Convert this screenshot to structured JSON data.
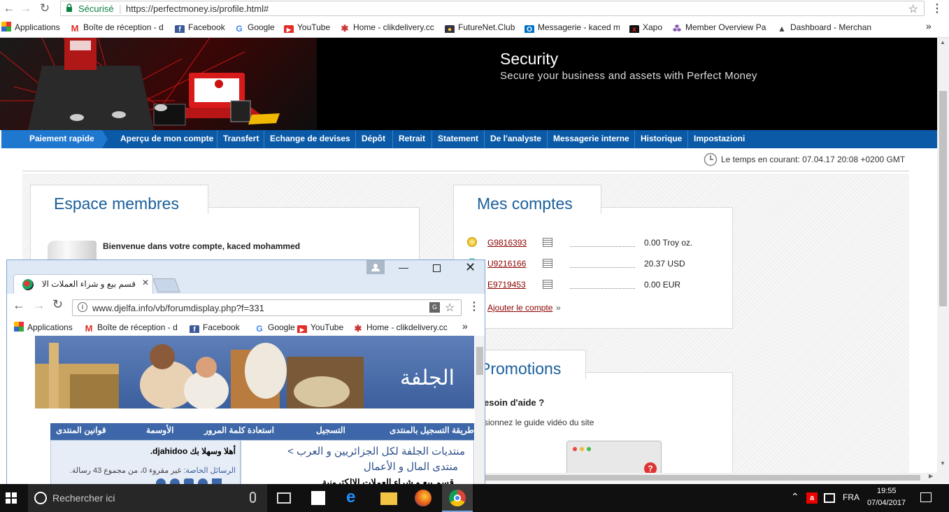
{
  "browser": {
    "secure_label": "Sécurisé",
    "url": "https://perfectmoney.is/profile.html#",
    "bookmarks": [
      {
        "label": "Applications",
        "icon": "apps-grid-icon"
      },
      {
        "label": "Boîte de réception - d",
        "icon": "gmail-icon"
      },
      {
        "label": "Facebook",
        "icon": "facebook-icon"
      },
      {
        "label": "Google",
        "icon": "google-icon"
      },
      {
        "label": "YouTube",
        "icon": "youtube-icon"
      },
      {
        "label": "Home - clikdelivery.cc",
        "icon": "clikdelivery-icon"
      },
      {
        "label": "FutureNet.Club",
        "icon": "futurenet-icon"
      },
      {
        "label": "Messagerie - kaced m",
        "icon": "outlook-icon"
      },
      {
        "label": "Xapo",
        "icon": "xapo-icon"
      },
      {
        "label": "Member Overview Pa",
        "icon": "member-icon"
      },
      {
        "label": "Dashboard - Merchan",
        "icon": "dashboard-icon"
      }
    ],
    "overflow": "»"
  },
  "pm": {
    "hero_title": "Security",
    "hero_subtitle": "Secure your business and assets with Perfect Money",
    "nav": [
      "Paiement rapide",
      "Aperçu de mon compte",
      "Transfert",
      "Echange de devises",
      "Dépôt",
      "Retrait",
      "Statement",
      "De l'analyste",
      "Messagerie interne",
      "Historique",
      "Impostazioni"
    ],
    "time": "Le temps en courant: 07.04.17 20:08 +0200 GMT",
    "members_title": "Espace membres",
    "welcome": "Bienvenue dans votre compte, kaced mohammed",
    "accounts_title": "Mes comptes",
    "accounts": [
      {
        "id": "G9816393",
        "balance": "0.00 Troy oz."
      },
      {
        "id": "U9216166",
        "balance": "20.37 USD"
      },
      {
        "id": "E9719453",
        "balance": "0.00 EUR"
      }
    ],
    "add_account": "Ajouter le compte",
    "add_account_arrow": "»",
    "promotions_title": "Promotions",
    "help_title": "esoin d'aide ?",
    "help_text": "sionnez le guide vidéo du site"
  },
  "forum": {
    "tab_title": "قسم بيع و شراء العملات الا",
    "url": "www.djelfa.info/vb/forumdisplay.php?f=331",
    "bookmarks": [
      "Applications",
      "Boîte de réception - d",
      "Facebook",
      "Google",
      "YouTube",
      "Home - clikdelivery.cc"
    ],
    "overflow": "»",
    "menu": [
      "قوانين المنتدى",
      "الأوسمة",
      "استعادة كلمة المرور",
      "التسجيل",
      "طريقة التسجيل بالمنتدى"
    ],
    "welcome": "أهلا وسهلا بك djahidoo.",
    "pm_label": "الرسائل الخاصة:",
    "pm_text": "غير مقروء 0، من مجموع 43 رسالة.",
    "breadcrumb_1": "منتديات الجلفة لكل الجزائريين و العرب >",
    "breadcrumb_2": "منتدى المال و الأعمال",
    "breadcrumb_3": "قسم بيع و شراء العملات الالكترونية"
  },
  "taskbar": {
    "search_placeholder": "Rechercher ici",
    "lang": "FRA",
    "time": "19:55",
    "date": "07/04/2017"
  }
}
